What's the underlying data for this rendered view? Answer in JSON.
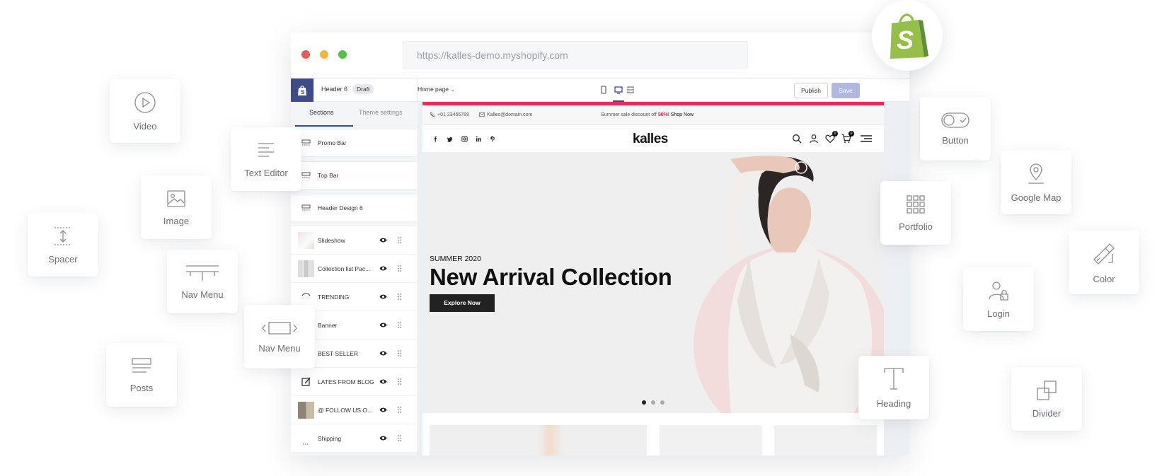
{
  "browser": {
    "url": "https://kalles-demo.myshopify.com",
    "traffic_lights": [
      "#ee5a52",
      "#f5b53a",
      "#52c146"
    ]
  },
  "editor": {
    "theme_name": "Header 6",
    "theme_status": "Draft",
    "page_selector": "Home page",
    "publish_label": "Publish",
    "save_label": "Save",
    "tabs": [
      "Sections",
      "Theme settings"
    ],
    "fixed_sections": [
      "Promo Bar",
      "Top Bar",
      "Header Design 6"
    ],
    "sections": [
      "Slideshow",
      "Collection list Pac...",
      "TRENDING",
      "Banner",
      "BEST SELLER",
      "LATES FROM BLOG",
      "@ FOLLOW US O...",
      "Shipping"
    ],
    "accent_color": "#3e4a8a"
  },
  "site": {
    "phone": "+01 23456789",
    "email": "Kalles@domain.com",
    "promo_text": "Summer sale discount off ",
    "promo_highlight": "50%",
    "promo_link": "! Shop Now",
    "logo": "kalles",
    "wishlist_count": "0",
    "cart_count": "0",
    "hero_subtitle": "SUMMER 2020",
    "hero_title": "New Arrival Collection",
    "hero_button": "Explore Now",
    "promo_bar_color": "#ea2b5c"
  },
  "widgets": {
    "video": "Video",
    "text_editor": "Text Editor",
    "image": "Image",
    "spacer": "Spacer",
    "nav_menu_1": "Nav Menu",
    "nav_menu_2": "Nav Menu",
    "posts": "Posts",
    "button": "Button",
    "google_map": "Google Map",
    "portfolio": "Portfolio",
    "color": "Color",
    "login": "Login",
    "heading": "Heading",
    "divider": "Divider"
  },
  "brand": {
    "shopify_green": "#95bf47"
  }
}
